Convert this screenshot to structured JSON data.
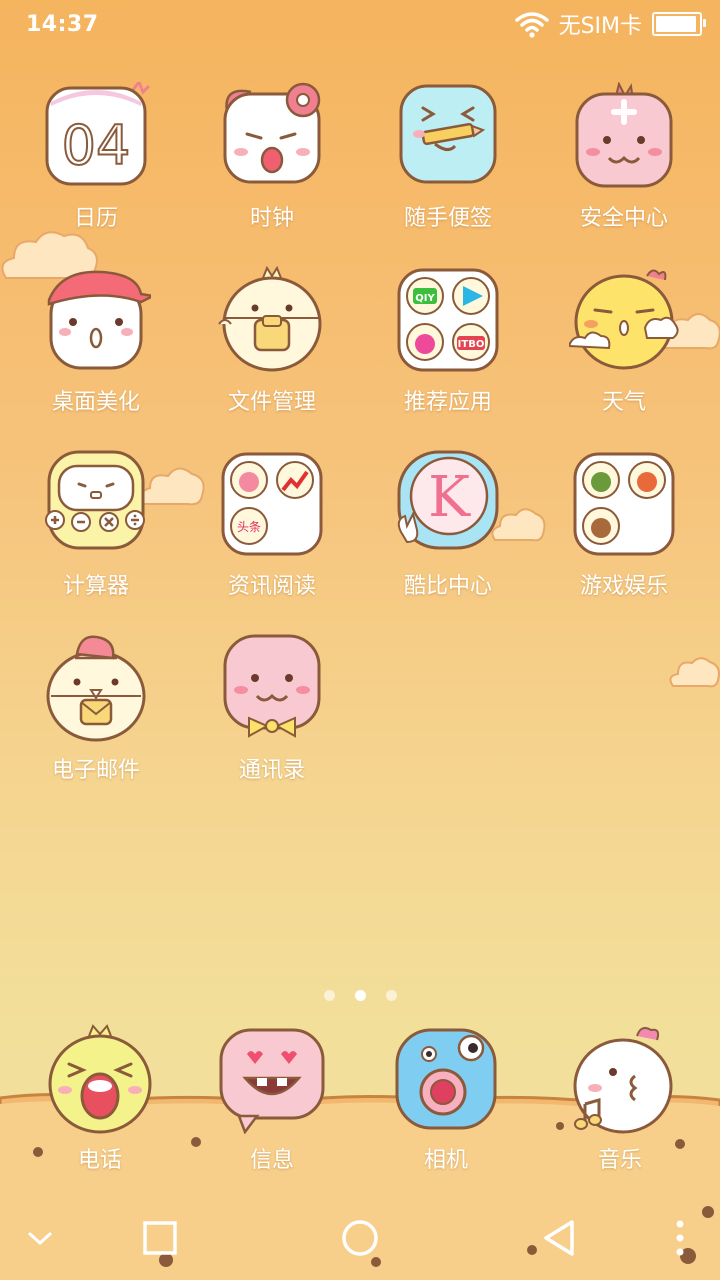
{
  "status": {
    "time": "14:37",
    "carrier": "无SIM卡",
    "icons": [
      "wifi-icon",
      "battery-icon"
    ],
    "battery_level": 0.95
  },
  "apps": [
    {
      "label": "日历",
      "icon": "calendar-icon",
      "date_text": "04"
    },
    {
      "label": "时钟",
      "icon": "clock-icon"
    },
    {
      "label": "随手便签",
      "icon": "notes-icon"
    },
    {
      "label": "安全中心",
      "icon": "security-icon"
    },
    {
      "label": "桌面美化",
      "icon": "theme-icon"
    },
    {
      "label": "文件管理",
      "icon": "file-manager-icon"
    },
    {
      "label": "推荐应用",
      "icon": "recommended-apps-folder-icon",
      "folder_text": [
        "QIY",
        "ITBO"
      ]
    },
    {
      "label": "天气",
      "icon": "weather-icon"
    },
    {
      "label": "计算器",
      "icon": "calculator-icon"
    },
    {
      "label": "资讯阅读",
      "icon": "news-folder-icon",
      "folder_text": [
        "头条"
      ]
    },
    {
      "label": "酷比中心",
      "icon": "koobee-center-icon",
      "badge_letter": "K"
    },
    {
      "label": "游戏娱乐",
      "icon": "games-folder-icon"
    },
    {
      "label": "电子邮件",
      "icon": "email-icon"
    },
    {
      "label": "通讯录",
      "icon": "contacts-icon"
    }
  ],
  "page_indicator": {
    "count": 3,
    "active": 2
  },
  "dock": [
    {
      "label": "电话",
      "icon": "phone-icon"
    },
    {
      "label": "信息",
      "icon": "messages-icon"
    },
    {
      "label": "相机",
      "icon": "camera-icon"
    },
    {
      "label": "音乐",
      "icon": "music-icon"
    }
  ],
  "navbar": [
    "collapse-icon",
    "recents-icon",
    "home-icon",
    "back-icon",
    "menu-icon"
  ],
  "colors": {
    "bg_top": "#f5b45e",
    "bg_bottom": "#f3e0a0",
    "ground": "#f0b060",
    "outline": "#8a5a3a",
    "label": "#ffffff"
  }
}
